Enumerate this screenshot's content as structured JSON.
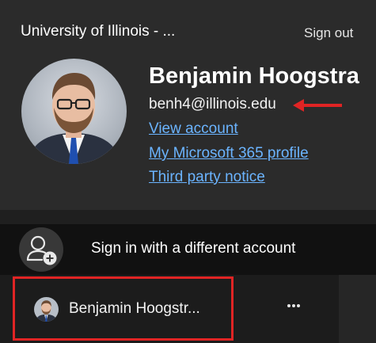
{
  "header": {
    "organization": "University of Illinois - ...",
    "sign_out_label": "Sign out"
  },
  "profile": {
    "name": "Benjamin Hoogstra",
    "email": "benh4@illinois.edu",
    "links": {
      "view_account": "View account",
      "m365_profile": "My Microsoft 365 profile",
      "third_party": "Third party notice"
    }
  },
  "different_account": {
    "label": "Sign in with a different account",
    "icon": "add-person-icon"
  },
  "accounts": [
    {
      "name": "Benjamin Hoogstr...",
      "more_icon": "more-horizontal-icon"
    }
  ],
  "colors": {
    "link": "#6bb4ff",
    "annotation_red": "#e02424",
    "header_bg": "#2b2b2b",
    "panel_bg": "#111111"
  }
}
